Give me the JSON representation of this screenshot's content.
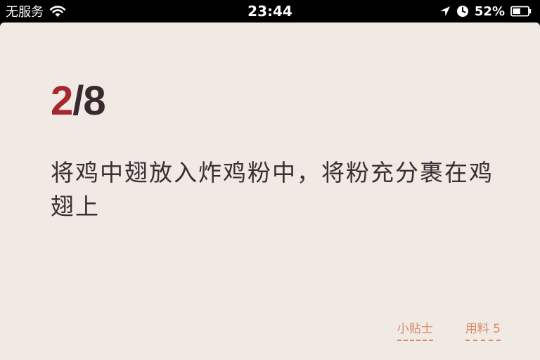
{
  "status_bar": {
    "carrier": "无服务",
    "time": "23:44",
    "battery": "52%",
    "icons": [
      "wifi-icon",
      "location-arrow-icon",
      "alarm-clock-icon",
      "battery-icon"
    ]
  },
  "step": {
    "current": "2",
    "separator_total": "/8",
    "current_value": 2,
    "total_value": 8,
    "text": "将鸡中翅放入炸鸡粉中，将粉充分裹在鸡翅上"
  },
  "links": {
    "tips": "小贴士",
    "ingredients": "用料 5"
  },
  "colors": {
    "card_background": "#f1e9e4",
    "accent_red": "#a6282e",
    "text_dark": "#3a2e33",
    "link_orange": "#d98a62"
  }
}
